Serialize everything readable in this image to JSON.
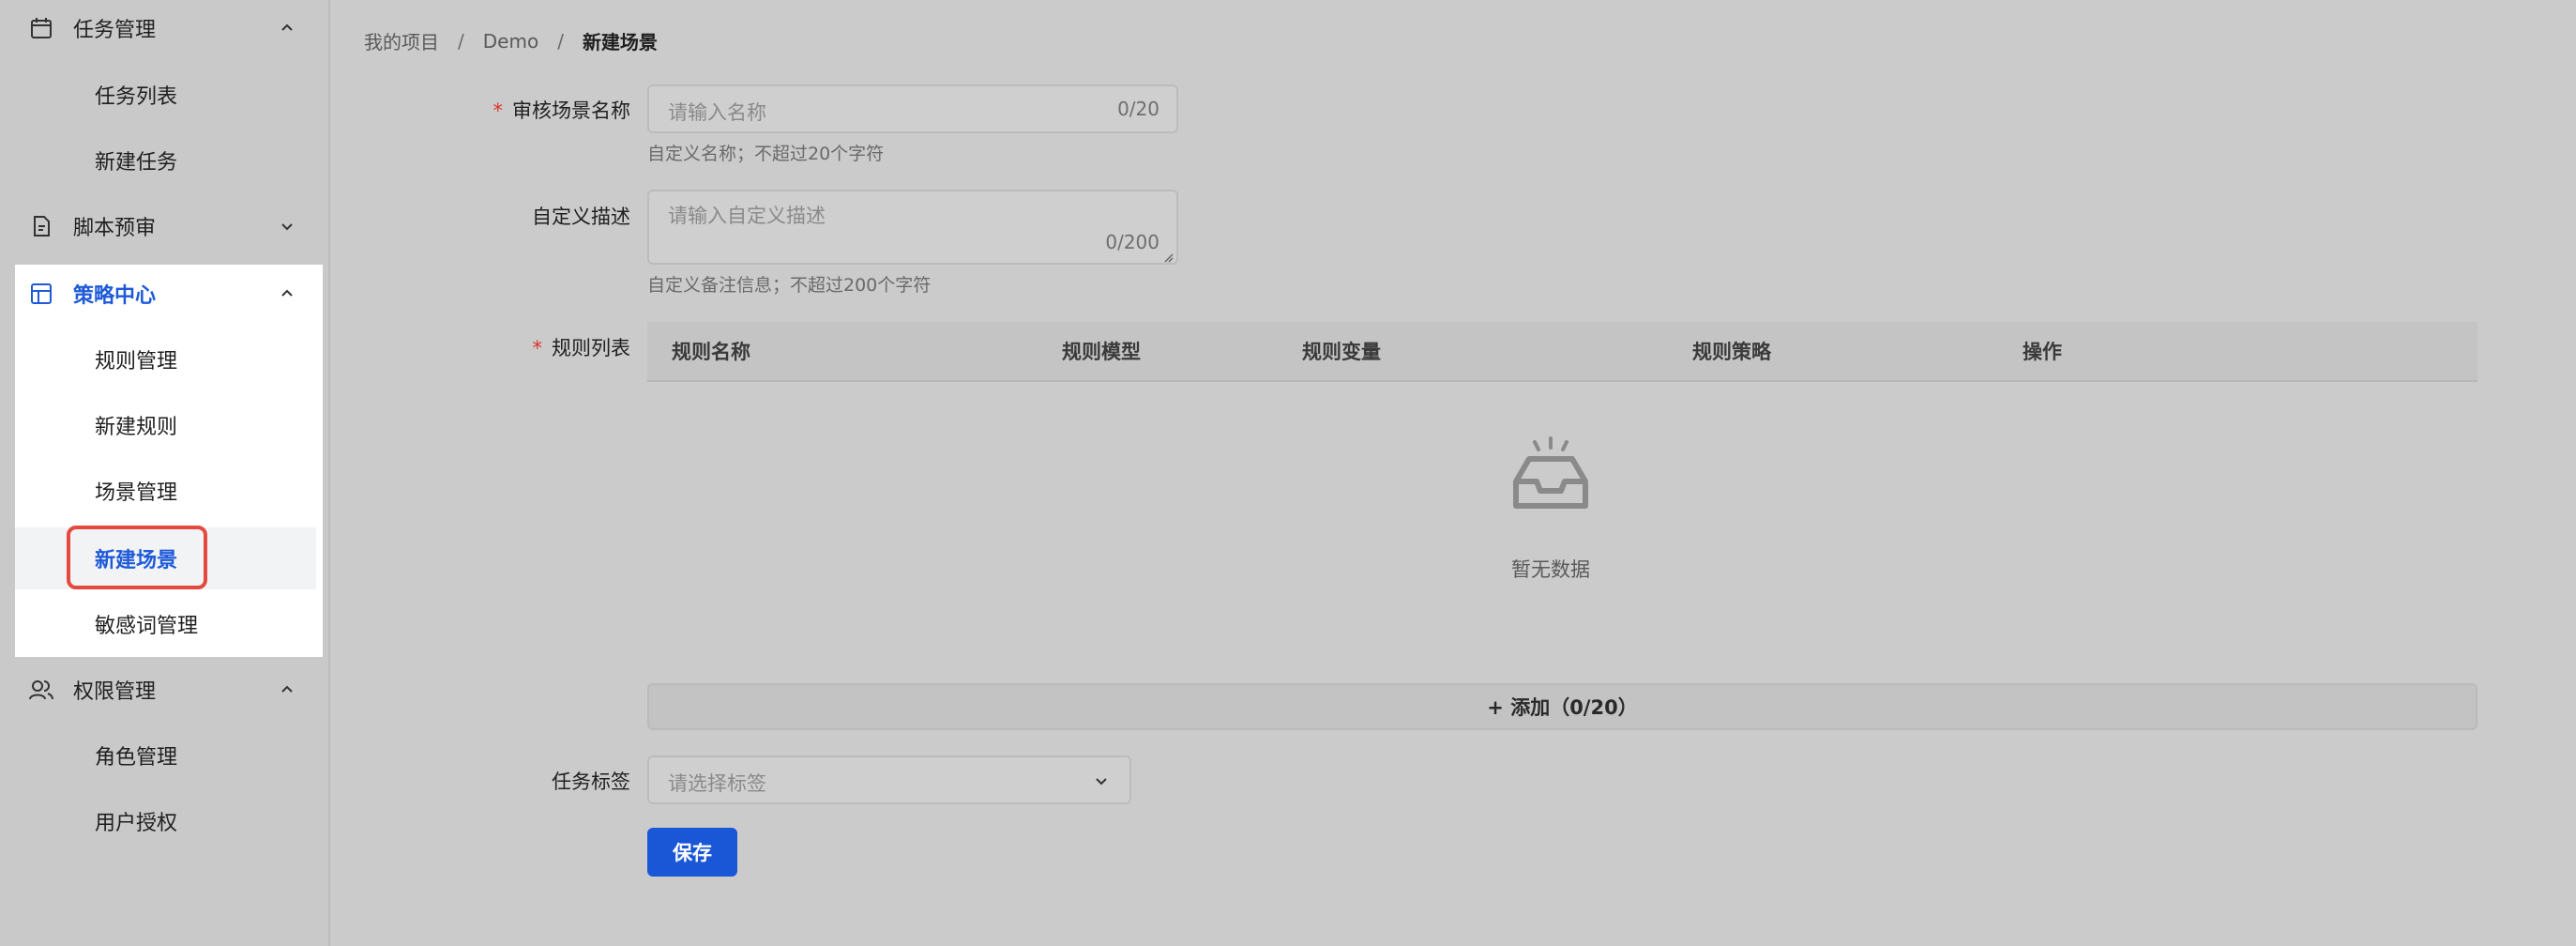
{
  "sidebar": {
    "groups": [
      {
        "label": "任务管理",
        "icon": "calendar-icon",
        "expanded": true,
        "items": [
          {
            "label": "任务列表"
          },
          {
            "label": "新建任务"
          }
        ]
      },
      {
        "label": "脚本预审",
        "icon": "document-icon",
        "expanded": false,
        "items": []
      },
      {
        "label": "策略中心",
        "icon": "layout-icon",
        "expanded": true,
        "active": true,
        "items": [
          {
            "label": "规则管理"
          },
          {
            "label": "新建规则"
          },
          {
            "label": "场景管理"
          },
          {
            "label": "新建场景",
            "active": true
          },
          {
            "label": "敏感词管理"
          }
        ]
      },
      {
        "label": "权限管理",
        "icon": "users-icon",
        "expanded": true,
        "items": [
          {
            "label": "角色管理"
          },
          {
            "label": "用户授权"
          }
        ]
      }
    ]
  },
  "breadcrumb": [
    "我的项目",
    "Demo",
    "新建场景"
  ],
  "breadcrumb_sep": "/",
  "form": {
    "name": {
      "required_mark": "*",
      "label": "审核场景名称",
      "placeholder": "请输入名称",
      "counter": "0/20",
      "hint": "自定义名称；不超过20个字符"
    },
    "description": {
      "label": "自定义描述",
      "placeholder": "请输入自定义描述",
      "counter": "0/200",
      "hint": "自定义备注信息；不超过200个字符"
    },
    "rules": {
      "required_mark": "*",
      "label": "规则列表",
      "columns": [
        "规则名称",
        "规则模型",
        "规则变量",
        "规则策略",
        "操作"
      ],
      "empty_text": "暂无数据",
      "add_label": "+ 添加（0/20）"
    },
    "tags": {
      "label": "任务标签",
      "placeholder": "请选择标签"
    },
    "save_label": "保存"
  },
  "colors": {
    "accent": "#1e5ad8",
    "required": "#d9342b",
    "highlight": "#e5483f"
  }
}
